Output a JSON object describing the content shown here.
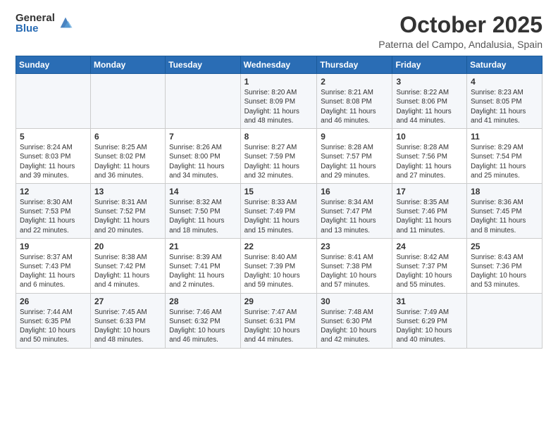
{
  "logo": {
    "general": "General",
    "blue": "Blue"
  },
  "header": {
    "month": "October 2025",
    "location": "Paterna del Campo, Andalusia, Spain"
  },
  "weekdays": [
    "Sunday",
    "Monday",
    "Tuesday",
    "Wednesday",
    "Thursday",
    "Friday",
    "Saturday"
  ],
  "weeks": [
    [
      {
        "day": "",
        "info": ""
      },
      {
        "day": "",
        "info": ""
      },
      {
        "day": "",
        "info": ""
      },
      {
        "day": "1",
        "info": "Sunrise: 8:20 AM\nSunset: 8:09 PM\nDaylight: 11 hours\nand 48 minutes."
      },
      {
        "day": "2",
        "info": "Sunrise: 8:21 AM\nSunset: 8:08 PM\nDaylight: 11 hours\nand 46 minutes."
      },
      {
        "day": "3",
        "info": "Sunrise: 8:22 AM\nSunset: 8:06 PM\nDaylight: 11 hours\nand 44 minutes."
      },
      {
        "day": "4",
        "info": "Sunrise: 8:23 AM\nSunset: 8:05 PM\nDaylight: 11 hours\nand 41 minutes."
      }
    ],
    [
      {
        "day": "5",
        "info": "Sunrise: 8:24 AM\nSunset: 8:03 PM\nDaylight: 11 hours\nand 39 minutes."
      },
      {
        "day": "6",
        "info": "Sunrise: 8:25 AM\nSunset: 8:02 PM\nDaylight: 11 hours\nand 36 minutes."
      },
      {
        "day": "7",
        "info": "Sunrise: 8:26 AM\nSunset: 8:00 PM\nDaylight: 11 hours\nand 34 minutes."
      },
      {
        "day": "8",
        "info": "Sunrise: 8:27 AM\nSunset: 7:59 PM\nDaylight: 11 hours\nand 32 minutes."
      },
      {
        "day": "9",
        "info": "Sunrise: 8:28 AM\nSunset: 7:57 PM\nDaylight: 11 hours\nand 29 minutes."
      },
      {
        "day": "10",
        "info": "Sunrise: 8:28 AM\nSunset: 7:56 PM\nDaylight: 11 hours\nand 27 minutes."
      },
      {
        "day": "11",
        "info": "Sunrise: 8:29 AM\nSunset: 7:54 PM\nDaylight: 11 hours\nand 25 minutes."
      }
    ],
    [
      {
        "day": "12",
        "info": "Sunrise: 8:30 AM\nSunset: 7:53 PM\nDaylight: 11 hours\nand 22 minutes."
      },
      {
        "day": "13",
        "info": "Sunrise: 8:31 AM\nSunset: 7:52 PM\nDaylight: 11 hours\nand 20 minutes."
      },
      {
        "day": "14",
        "info": "Sunrise: 8:32 AM\nSunset: 7:50 PM\nDaylight: 11 hours\nand 18 minutes."
      },
      {
        "day": "15",
        "info": "Sunrise: 8:33 AM\nSunset: 7:49 PM\nDaylight: 11 hours\nand 15 minutes."
      },
      {
        "day": "16",
        "info": "Sunrise: 8:34 AM\nSunset: 7:47 PM\nDaylight: 11 hours\nand 13 minutes."
      },
      {
        "day": "17",
        "info": "Sunrise: 8:35 AM\nSunset: 7:46 PM\nDaylight: 11 hours\nand 11 minutes."
      },
      {
        "day": "18",
        "info": "Sunrise: 8:36 AM\nSunset: 7:45 PM\nDaylight: 11 hours\nand 8 minutes."
      }
    ],
    [
      {
        "day": "19",
        "info": "Sunrise: 8:37 AM\nSunset: 7:43 PM\nDaylight: 11 hours\nand 6 minutes."
      },
      {
        "day": "20",
        "info": "Sunrise: 8:38 AM\nSunset: 7:42 PM\nDaylight: 11 hours\nand 4 minutes."
      },
      {
        "day": "21",
        "info": "Sunrise: 8:39 AM\nSunset: 7:41 PM\nDaylight: 11 hours\nand 2 minutes."
      },
      {
        "day": "22",
        "info": "Sunrise: 8:40 AM\nSunset: 7:39 PM\nDaylight: 10 hours\nand 59 minutes."
      },
      {
        "day": "23",
        "info": "Sunrise: 8:41 AM\nSunset: 7:38 PM\nDaylight: 10 hours\nand 57 minutes."
      },
      {
        "day": "24",
        "info": "Sunrise: 8:42 AM\nSunset: 7:37 PM\nDaylight: 10 hours\nand 55 minutes."
      },
      {
        "day": "25",
        "info": "Sunrise: 8:43 AM\nSunset: 7:36 PM\nDaylight: 10 hours\nand 53 minutes."
      }
    ],
    [
      {
        "day": "26",
        "info": "Sunrise: 7:44 AM\nSunset: 6:35 PM\nDaylight: 10 hours\nand 50 minutes."
      },
      {
        "day": "27",
        "info": "Sunrise: 7:45 AM\nSunset: 6:33 PM\nDaylight: 10 hours\nand 48 minutes."
      },
      {
        "day": "28",
        "info": "Sunrise: 7:46 AM\nSunset: 6:32 PM\nDaylight: 10 hours\nand 46 minutes."
      },
      {
        "day": "29",
        "info": "Sunrise: 7:47 AM\nSunset: 6:31 PM\nDaylight: 10 hours\nand 44 minutes."
      },
      {
        "day": "30",
        "info": "Sunrise: 7:48 AM\nSunset: 6:30 PM\nDaylight: 10 hours\nand 42 minutes."
      },
      {
        "day": "31",
        "info": "Sunrise: 7:49 AM\nSunset: 6:29 PM\nDaylight: 10 hours\nand 40 minutes."
      },
      {
        "day": "",
        "info": ""
      }
    ]
  ]
}
